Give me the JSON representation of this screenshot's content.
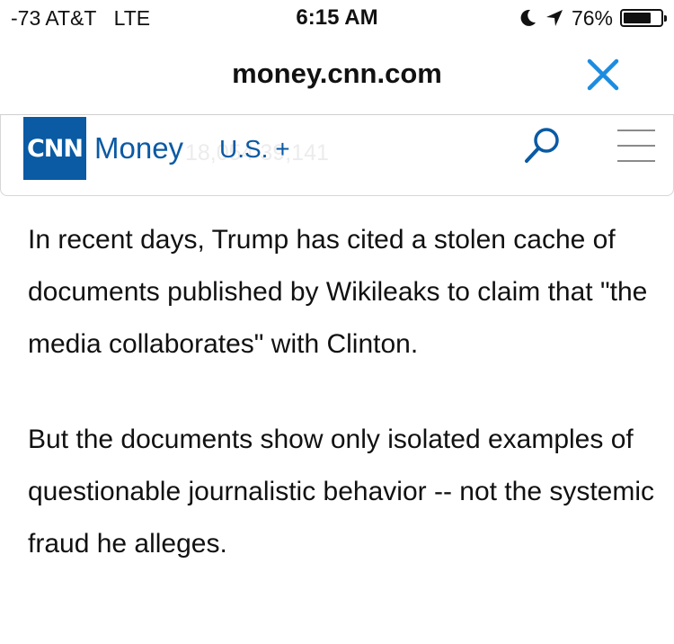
{
  "status_bar": {
    "signal": "-73 AT&T",
    "network": "LTE",
    "time": "6:15 AM",
    "battery_percent": "76%",
    "battery_level": 0.76,
    "icons": [
      "moon-icon",
      "location-arrow-icon",
      "battery-icon"
    ]
  },
  "url_bar": {
    "domain": "money.cnn.com",
    "close_icon": "close-icon",
    "accent": "#1d8ce0"
  },
  "site_header": {
    "logo_text": "CNN",
    "section_label": "Money",
    "edition_link": "U.S. +",
    "ticker_ghost": "18,054  39,141",
    "search_icon": "search-icon",
    "menu_icon": "hamburger-menu-icon",
    "brand_color": "#0a5aa4"
  },
  "article": {
    "paragraphs": [
      "In recent days, Trump has cited a stolen cache of documents published by Wikileaks to claim that \"the media collaborates\" with Clinton.",
      "But the documents show only isolated examples of questionable journalistic behavior -- not the systemic fraud he alleges."
    ]
  }
}
